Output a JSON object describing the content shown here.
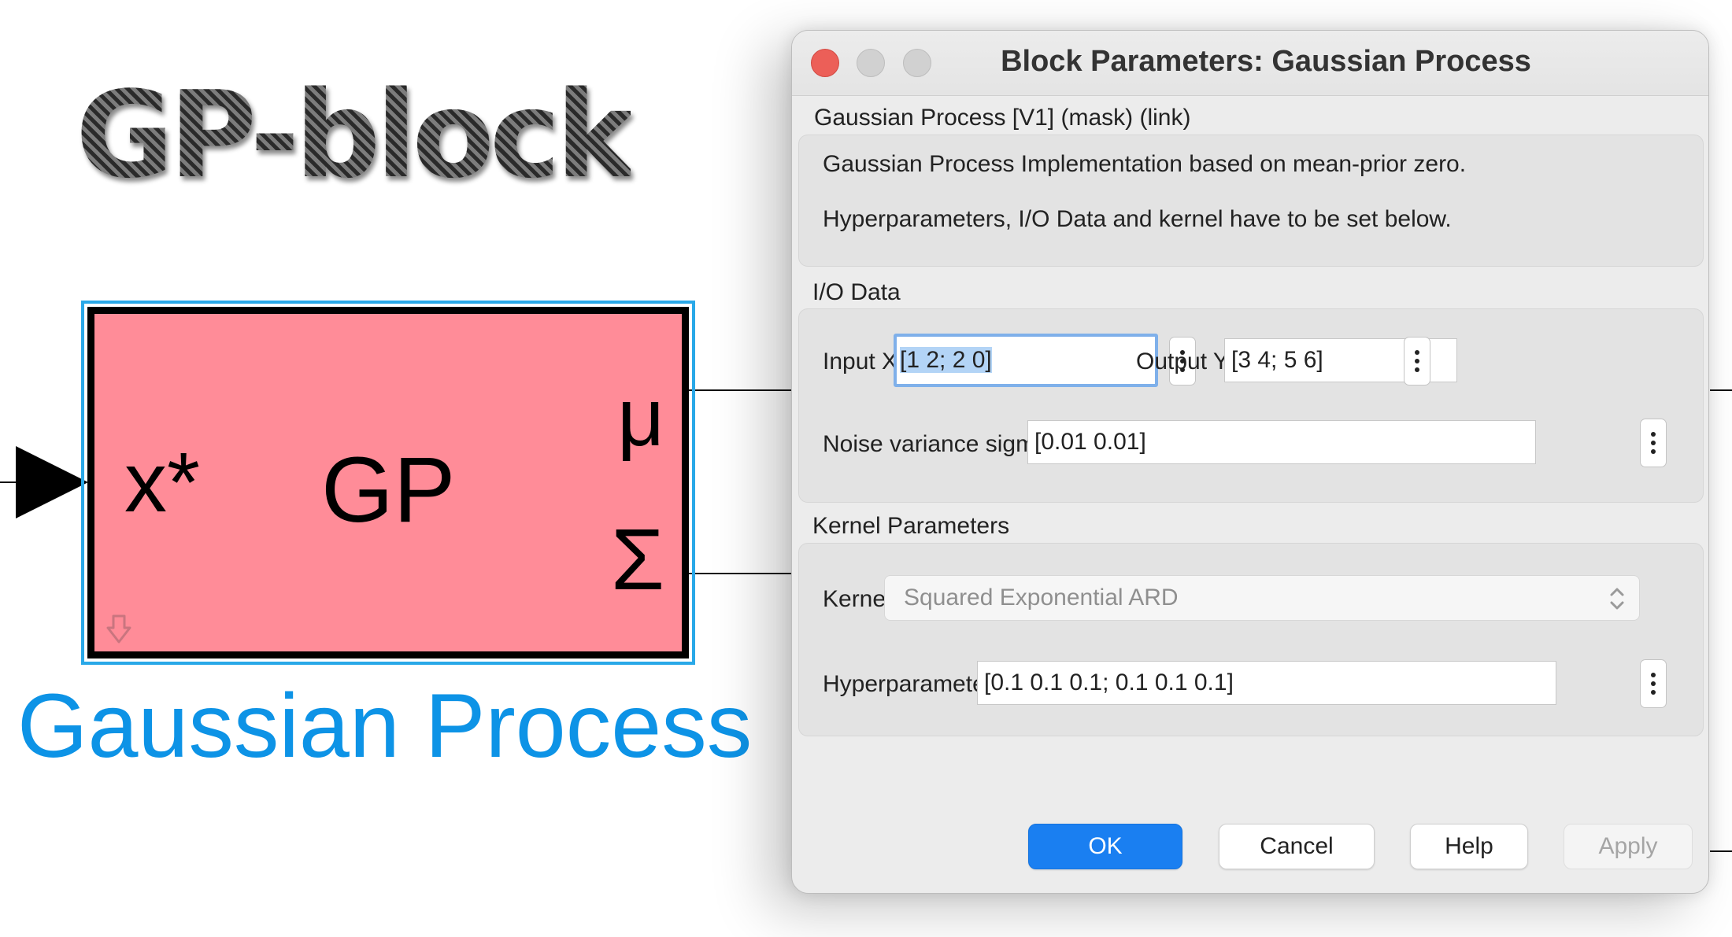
{
  "diagram": {
    "heading": "GP-block",
    "block": {
      "input_label": "x*",
      "name_label": "GP",
      "output_mean_label": "μ",
      "output_cov_label": "Σ",
      "fill_color": "#ff8c98",
      "selection_color": "#29a8e8"
    },
    "caption": "Gaussian Process",
    "caption_color": "#0d93e6"
  },
  "dialog": {
    "title": "Block Parameters: Gaussian Process",
    "mask_header": "Gaussian Process [V1] (mask) (link)",
    "description": [
      "Gaussian Process Implementation based on mean-prior zero.",
      "Hyperparameters, I/O Data and kernel have to be set below."
    ],
    "io_section": {
      "title": "I/O Data",
      "input_x_label": "Input X",
      "input_x_value": "[1 2; 2 0]",
      "output_y_label": "Output Y",
      "output_y_value": "[3 4; 5 6]",
      "noise_label": "Noise variance sigma_n",
      "noise_value": "[0.01 0.01]"
    },
    "kernel_section": {
      "title": "Kernel Parameters",
      "kernel_label": "Kernel",
      "kernel_value": "Squared Exponential ARD",
      "hyper_label": "Hyperparameters",
      "hyper_value": "[0.1 0.1 0.1; 0.1 0.1 0.1]"
    },
    "buttons": {
      "ok": "OK",
      "cancel": "Cancel",
      "help": "Help",
      "apply": "Apply"
    },
    "colors": {
      "close": "#ec5f58",
      "primary_button": "#1a7ff1",
      "focus_ring": "#7fb0ea"
    }
  }
}
